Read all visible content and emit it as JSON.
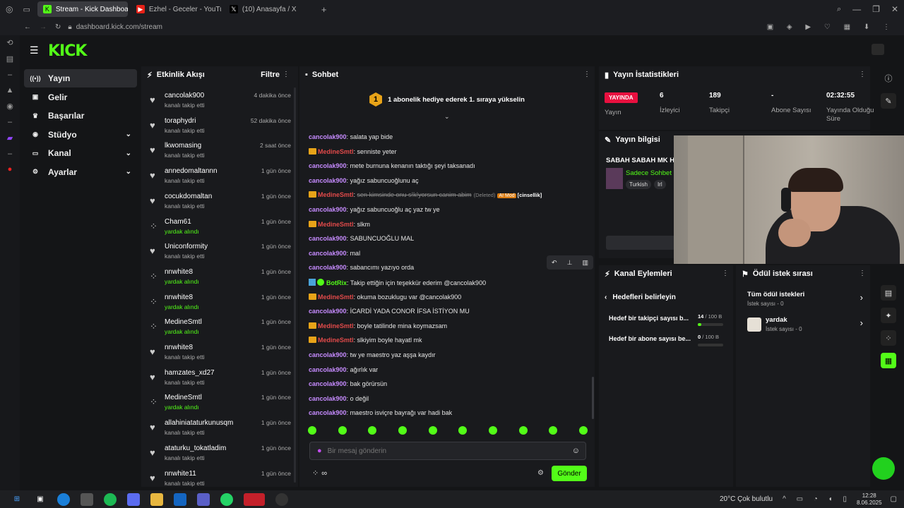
{
  "browser": {
    "tabs": [
      {
        "label": "Stream - Kick Dashboard",
        "active": true,
        "icon": "kick-favicon"
      },
      {
        "label": "Ezhel - Geceler - YouTube",
        "active": false,
        "icon": "youtube-favicon"
      },
      {
        "label": "(10) Anasayfa / X",
        "active": false,
        "icon": "x-favicon"
      }
    ],
    "url": "dashboard.kick.com/stream"
  },
  "app": {
    "logo": "KICK",
    "accent": "#53fc18"
  },
  "nav": {
    "items": [
      {
        "label": "Yayın",
        "icon": "broadcast-icon",
        "active": true,
        "has_chevron": false
      },
      {
        "label": "Gelir",
        "icon": "wallet-icon",
        "active": false,
        "has_chevron": false
      },
      {
        "label": "Başarılar",
        "icon": "trophy-icon",
        "active": false,
        "has_chevron": false
      },
      {
        "label": "Stüdyo",
        "icon": "studio-icon",
        "active": false,
        "has_chevron": true
      },
      {
        "label": "Kanal",
        "icon": "channel-icon",
        "active": false,
        "has_chevron": true
      },
      {
        "label": "Ayarlar",
        "icon": "gear-icon",
        "active": false,
        "has_chevron": true
      }
    ]
  },
  "activity": {
    "title": "Etkinlik Akışı",
    "filter_label": "Filtre",
    "items": [
      {
        "name": "cancolak900",
        "action": "kanalı takip etti",
        "time": "4 dakika önce",
        "type": "follow"
      },
      {
        "name": "toraphydri",
        "action": "kanalı takip etti",
        "time": "52 dakika önce",
        "type": "follow"
      },
      {
        "name": "lkwomasing",
        "action": "kanalı takip etti",
        "time": "2 saat önce",
        "type": "follow"
      },
      {
        "name": "annedomaltannn",
        "action": "kanalı takip etti",
        "time": "1 gün önce",
        "type": "follow"
      },
      {
        "name": "cocukdomaltan",
        "action": "kanalı takip etti",
        "time": "1 gün önce",
        "type": "follow"
      },
      {
        "name": "Cham61",
        "action": "yardak alındı",
        "time": "1 gün önce",
        "type": "reward"
      },
      {
        "name": "Uniconformity",
        "action": "kanalı takip etti",
        "time": "1 gün önce",
        "type": "follow"
      },
      {
        "name": "nnwhite8",
        "action": "yardak alındı",
        "time": "1 gün önce",
        "type": "reward"
      },
      {
        "name": "nnwhite8",
        "action": "yardak alındı",
        "time": "1 gün önce",
        "type": "reward"
      },
      {
        "name": "MedineSmtl",
        "action": "yardak alındı",
        "time": "1 gün önce",
        "type": "reward"
      },
      {
        "name": "nnwhite8",
        "action": "kanalı takip etti",
        "time": "1 gün önce",
        "type": "follow"
      },
      {
        "name": "hamzates_xd27",
        "action": "kanalı takip etti",
        "time": "1 gün önce",
        "type": "follow"
      },
      {
        "name": "MedineSmtl",
        "action": "yardak alındı",
        "time": "1 gün önce",
        "type": "reward"
      },
      {
        "name": "allahiniataturkunusqm",
        "action": "kanalı takip etti",
        "time": "1 gün önce",
        "type": "follow"
      },
      {
        "name": "ataturku_tokatladim",
        "action": "kanalı takip etti",
        "time": "1 gün önce",
        "type": "follow"
      },
      {
        "name": "nnwhite11",
        "action": "kanalı takip etti",
        "time": "1 gün önce",
        "type": "follow"
      }
    ]
  },
  "chat": {
    "title": "Sohbet",
    "banner": "1 abonelik hediye ederek 1. sıraya yükselin",
    "banner_rank": "1",
    "messages": [
      {
        "user": "cancolak900",
        "cls": "cancol",
        "badge": false,
        "text": "salata yap bide"
      },
      {
        "user": "MedineSmtl",
        "cls": "medine",
        "badge": true,
        "text": "senniste yeter"
      },
      {
        "user": "cancolak900",
        "cls": "cancol",
        "badge": false,
        "text": "mete burnuna kenanın taktığı şeyi taksanadı"
      },
      {
        "user": "cancolak900",
        "cls": "cancol",
        "badge": false,
        "text": "yağız sabuncuoğlunu aç"
      },
      {
        "user": "MedineSmtl",
        "cls": "medine",
        "badge": true,
        "text": "sen kimsinde onu s!k!yorsun canim abim",
        "deleted": true,
        "deleted_label": "(Deleted)",
        "mod_label": "AI Mod",
        "tag_label": "[cinsellik]"
      },
      {
        "user": "cancolak900",
        "cls": "cancol",
        "badge": false,
        "text": "yağız sabuncuoğlu aç yaz tw ye"
      },
      {
        "user": "MedineSmtl",
        "cls": "medine",
        "badge": true,
        "text": "slkm"
      },
      {
        "user": "cancolak900",
        "cls": "cancol",
        "badge": false,
        "text": "SABUNCUOĞLU MAL"
      },
      {
        "user": "cancolak900",
        "cls": "cancol",
        "badge": false,
        "text": "mal"
      },
      {
        "user": "cancolak900",
        "cls": "cancol",
        "badge": false,
        "text": "sabancımı yazıyo orda"
      },
      {
        "user": "BotRix",
        "cls": "botrix",
        "badge": false,
        "bot": true,
        "text": "Takip ettiğin için teşekkür ederim @cancolak900"
      },
      {
        "user": "MedineSmtl",
        "cls": "medine",
        "badge": true,
        "text": "okuma bozuklugu var @cancolak900"
      },
      {
        "user": "cancolak900",
        "cls": "cancol",
        "badge": false,
        "text": "İCARDİ YADA CONOR İFSA İSTİYON MU"
      },
      {
        "user": "MedineSmtl",
        "cls": "medine",
        "badge": true,
        "text": "boyle tatilinde mina koymazsam"
      },
      {
        "user": "MedineSmtl",
        "cls": "medine",
        "badge": true,
        "text": "slkiyim boyle hayatl mk"
      },
      {
        "user": "cancolak900",
        "cls": "cancol",
        "badge": false,
        "text": "tw ye maestro yaz aşşa kaydır"
      },
      {
        "user": "cancolak900",
        "cls": "cancol",
        "badge": false,
        "text": "ağırlık var"
      },
      {
        "user": "cancolak900",
        "cls": "cancol",
        "badge": false,
        "text": "bak görürsün"
      },
      {
        "user": "cancolak900",
        "cls": "cancol",
        "badge": false,
        "text": "o değil"
      },
      {
        "user": "cancolak900",
        "cls": "cancol",
        "badge": false,
        "text": "maestro isviçre bayrağı var hadi bak"
      }
    ],
    "input_placeholder": "Bir mesaj gönderin",
    "send_label": "Gönder",
    "points_label": "∞"
  },
  "stats": {
    "title": "Yayın İstatistikleri",
    "live_label": "YAYINDA",
    "live_sub": "Yayın",
    "items": [
      {
        "value": "6",
        "label": "İzleyici"
      },
      {
        "value": "189",
        "label": "Takipçi"
      },
      {
        "value": "-",
        "label": "Abone Sayısı"
      },
      {
        "value": "02:32:55",
        "label": "Yayında Olduğu Süre"
      }
    ]
  },
  "stream_info": {
    "title": "Yayın bilgisi",
    "stream_title": "SABAH SABAH MK H",
    "category": "Sadece Sohbet",
    "tags": [
      "Turkish",
      "Irl"
    ]
  },
  "channel_actions": {
    "title": "Kanal Eylemleri",
    "back_label": "Hedefleri belirleyin",
    "goals": [
      {
        "label": "Hedef bir takipçi sayısı b...",
        "progress": "14",
        "target": "/ 100 B",
        "fraction": 0.14
      },
      {
        "label": "Hedef bir abone sayısı be...",
        "progress": "0",
        "target": "/ 100 B",
        "fraction": 0
      }
    ]
  },
  "rewards": {
    "title": "Ödül istek sırası",
    "items": [
      {
        "name": "Tüm ödül istekleri",
        "sub": "İstek sayısı - 0",
        "has_icon": false
      },
      {
        "name": "yardak",
        "sub": "İstek sayısı - 0",
        "has_icon": true
      }
    ]
  },
  "taskbar": {
    "weather": "20°C  Çok bulutlu",
    "time": "12:28",
    "date": "8.06.2025"
  }
}
